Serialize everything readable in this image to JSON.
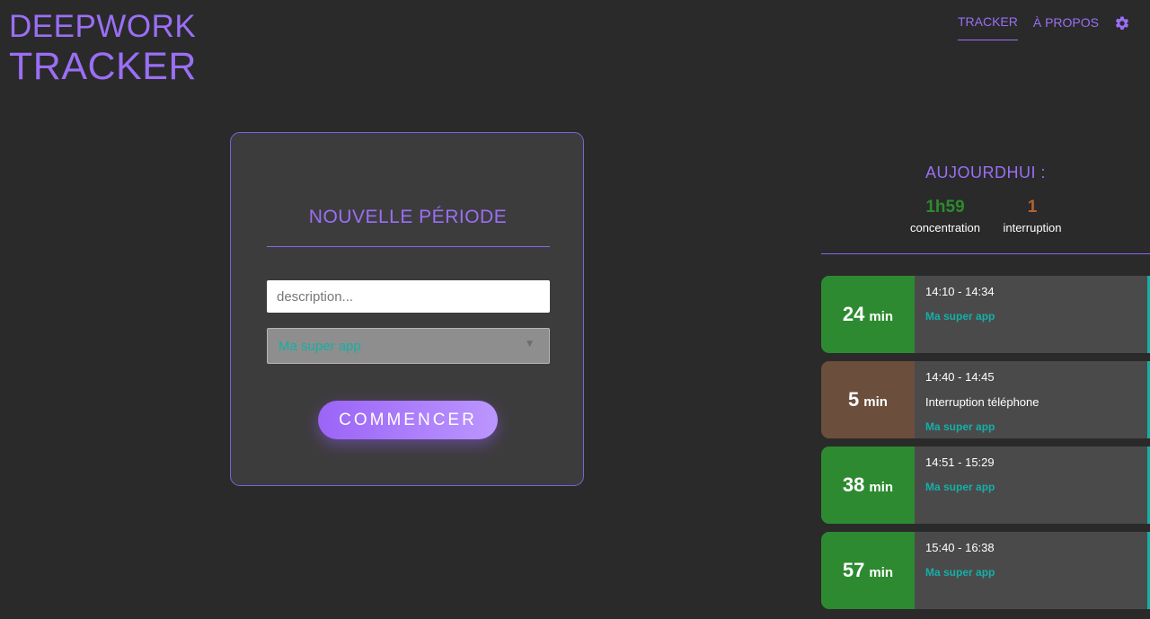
{
  "app": {
    "logo_line1": "DEEPWORK",
    "logo_line2": "TRACKER"
  },
  "nav": {
    "items": [
      {
        "label": "TRACKER",
        "active": true
      },
      {
        "label": "À PROPOS",
        "active": false
      }
    ],
    "settings_icon": "gear-icon",
    "accent_color": "#9a6ff5"
  },
  "form": {
    "title": "NOUVELLE PÉRIODE",
    "description_placeholder": "description...",
    "description_value": "",
    "project_selected": "Ma super app",
    "start_label": "COMMENCER"
  },
  "today": {
    "title": "AUJOURDHUI :",
    "concentration_value": "1h59",
    "concentration_label": "concentration",
    "interruption_value": "1",
    "interruption_label": "interruption"
  },
  "periods": [
    {
      "type": "focus",
      "duration": "24",
      "unit": "min",
      "time": "14:10 - 14:34",
      "description": "",
      "project": "Ma super app"
    },
    {
      "type": "interrupt",
      "duration": "5",
      "unit": "min",
      "time": "14:40 - 14:45",
      "description": "Interruption téléphone",
      "project": "Ma super app"
    },
    {
      "type": "focus",
      "duration": "38",
      "unit": "min",
      "time": "14:51 - 15:29",
      "description": "",
      "project": "Ma super app"
    },
    {
      "type": "focus",
      "duration": "57",
      "unit": "min",
      "time": "15:40 - 16:38",
      "description": "",
      "project": "Ma super app"
    }
  ],
  "colors": {
    "focus": "#2d8a30",
    "interrupt": "#6b4e3c",
    "project": "#13b0a6",
    "background": "#2a2a2a"
  }
}
